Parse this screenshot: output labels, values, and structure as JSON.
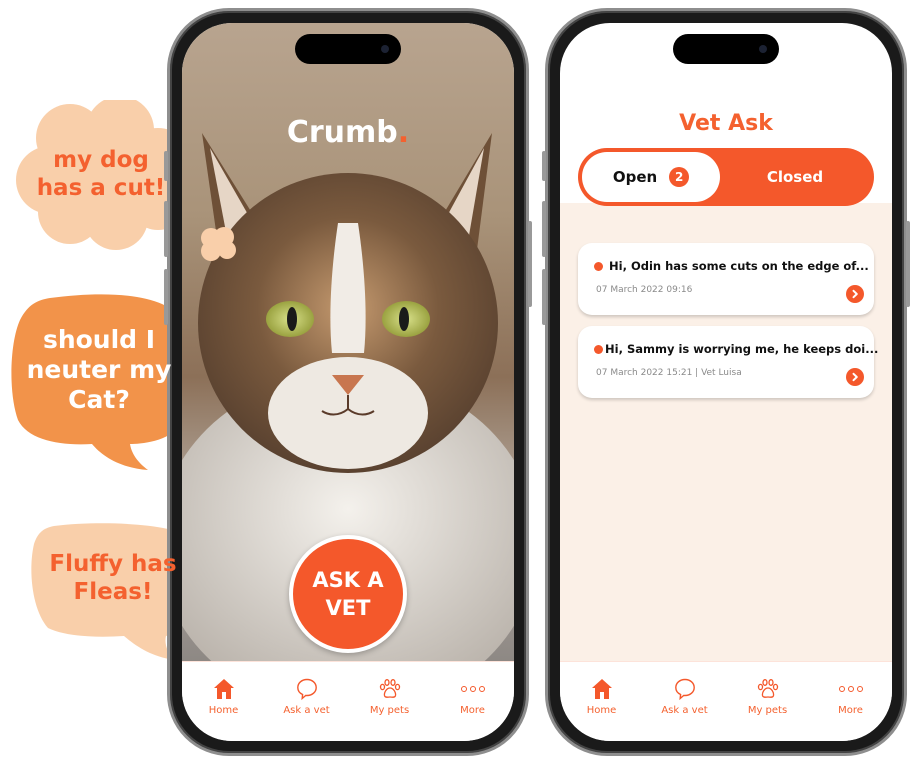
{
  "bubbles": [
    {
      "line1": "my dog",
      "line2": "has a cut!",
      "color": "#f9cfaa"
    },
    {
      "line1": "should I",
      "line2": "neuter my",
      "line3": "Cat?",
      "color": "#f2934a"
    },
    {
      "line1": "Fluffy has",
      "line2": "Fleas!",
      "color": "#f9cfaa"
    }
  ],
  "home_screen": {
    "brand": "Crumb",
    "brand_dot": ".",
    "ask_button_line1": "ASK A",
    "ask_button_line2": "VET",
    "accent": "#f4582b"
  },
  "vet_screen": {
    "title": "Vet Ask",
    "tabs": {
      "open_label": "Open",
      "open_count": "2",
      "closed_label": "Closed"
    },
    "questions": [
      {
        "title": "Hi, Odin has some cuts on the edge of...",
        "meta": "07 March 2022 09:16"
      },
      {
        "title": "Hi, Sammy is worrying me, he keeps doi...",
        "meta": "07 March 2022 15:21 | Vet Luisa"
      }
    ]
  },
  "tabbar": [
    {
      "label": "Home",
      "icon": "home-icon"
    },
    {
      "label": "Ask a vet",
      "icon": "chat-bubble-icon"
    },
    {
      "label": "My pets",
      "icon": "paw-icon"
    },
    {
      "label": "More",
      "icon": "more-dots-icon"
    }
  ]
}
